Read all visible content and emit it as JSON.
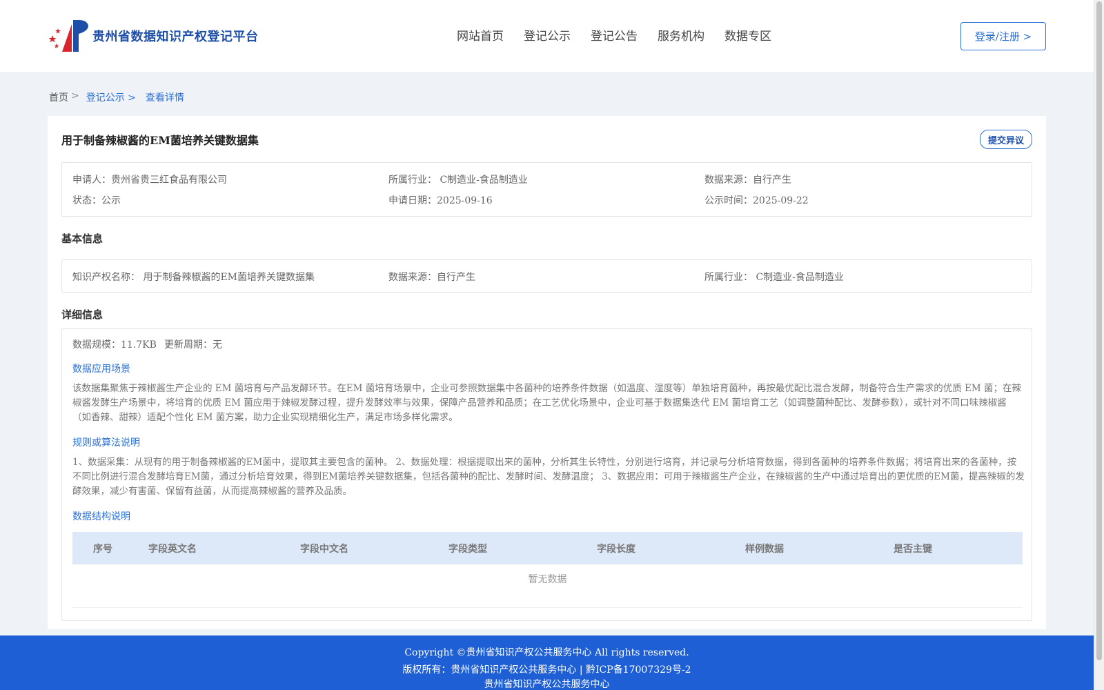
{
  "header": {
    "site_title": "贵州省数据知识产权登记平台",
    "nav": [
      "网站首页",
      "登记公示",
      "登记公告",
      "服务机构",
      "数据专区"
    ],
    "login_label": "登录/注册 >"
  },
  "breadcrumb": {
    "home": "首页",
    "sep": ">",
    "items": [
      "登记公示 >",
      "查看详情"
    ]
  },
  "detail": {
    "title": "用于制备辣椒酱的EM菌培养关键数据集",
    "objection_label": "提交异议",
    "summary": {
      "applicant": "申请人：贵州省贵三红食品有限公司",
      "industry": "所属行业： C制造业-食品制造业",
      "source": "数据来源：自行产生",
      "status": "状态：公示",
      "apply_date": "申请日期：2025-09-16",
      "publish_time": "公示时间：2025-09-22"
    },
    "basic_title": "基本信息",
    "basic": {
      "ip_name": "知识产权名称： 用于制备辣椒酱的EM菌培养关键数据集",
      "source": "数据来源：自行产生",
      "industry": "所属行业： C制造业-食品制造业"
    },
    "detail_title": "详细信息",
    "scale": "数据规模：11.7KB",
    "update_cycle": "更新周期：无",
    "scenario_title": "数据应用场景",
    "scenario_text": "该数据集聚焦于辣椒酱生产企业的 EM 菌培育与产品发酵环节。在EM 菌培育场景中，企业可参照数据集中各菌种的培养条件数据（如温度、湿度等）单独培育菌种，再按最优配比混合发酵，制备符合生产需求的优质 EM 菌；在辣椒酱发酵生产场景中，将培育的优质 EM 菌应用于辣椒发酵过程，提升发酵效率与效果，保障产品营养和品质；在工艺优化场景中，企业可基于数据集迭代 EM 菌培育工艺（如调整菌种配比、发酵参数），或针对不同口味辣椒酱（如香辣、甜辣）适配个性化 EM 菌方案，助力企业实现精细化生产，满足市场多样化需求。",
    "rules_title": "规则或算法说明",
    "rules_text": "1、数据采集：从现有的用于制备辣椒酱的EM菌中，提取其主要包含的菌种。 2、数据处理：根据提取出来的菌种，分析其生长特性，分别进行培育，并记录与分析培育数据，得到各菌种的培养条件数据；将培育出来的各菌种，按不同比例进行混合发酵培育EM菌，通过分析培育效果，得到EM菌培养关键数据集，包括各菌种的配比、发酵时间、发酵温度； 3、数据应用：可用于辣椒酱生产企业，在辣椒酱的生产中通过培育出的更优质的EM菌，提高辣椒的发酵效果，减少有害菌、保留有益菌，从而提高辣椒酱的营养及品质。",
    "structure_title": "数据结构说明",
    "table_headers": [
      "序号",
      "字段英文名",
      "字段中文名",
      "字段类型",
      "字段长度",
      "样例数据",
      "是否主键"
    ],
    "empty_text": "暂无数据"
  },
  "footer": {
    "copyright": "Copyright ©贵州省知识产权公共服务中心 All rights reserved.",
    "owner": "版权所有：贵州省知识产权公共服务中心 | 黔ICP备17007329号-2",
    "org": "贵州省知识产权公共服务中心"
  },
  "colors": {
    "accent": "#2a6fd6",
    "footer_bg": "#1f5fd5",
    "table_head_bg": "#dde9f8"
  }
}
